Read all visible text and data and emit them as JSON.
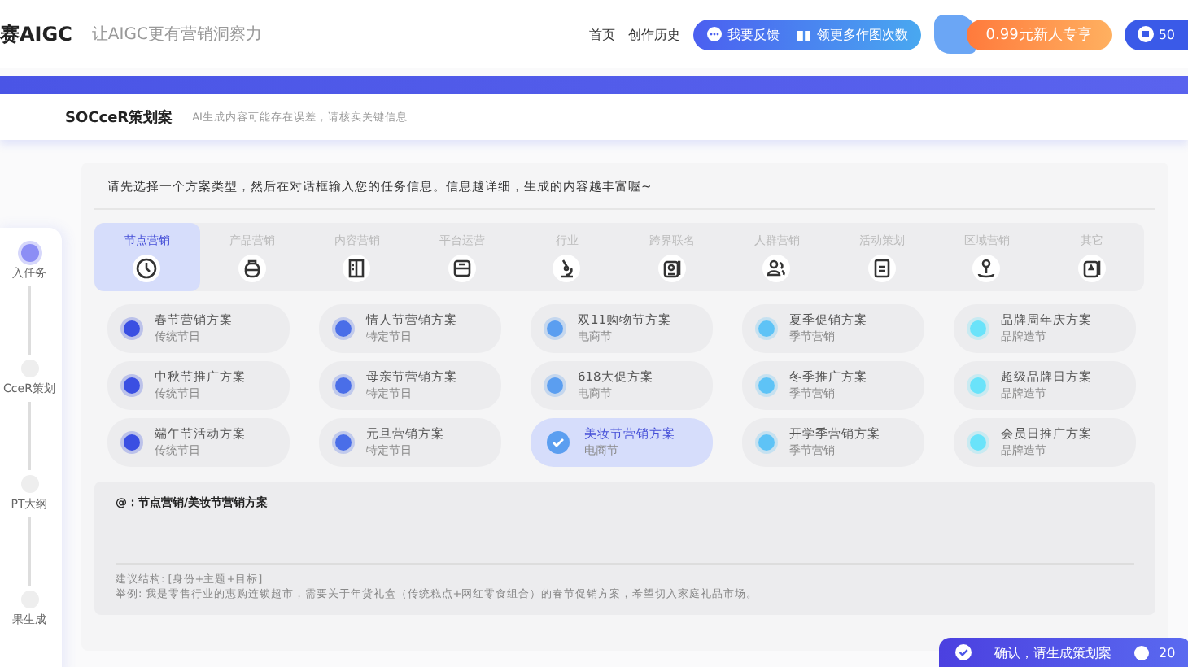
{
  "header": {
    "logo": "赛AIGC",
    "slogan": "让AIGC更有营销洞察力",
    "nav": [
      {
        "label": "首页"
      },
      {
        "label": "创作历史"
      }
    ],
    "feedback_button": "我要反馈",
    "more_button": "领更多作图次数",
    "promo_button": "0.99元新人专享",
    "credits": "50"
  },
  "title_bar": {
    "title": "SOCceR策划案",
    "notice": "AI生成内容可能存在误差，请核实关键信息"
  },
  "steps": [
    {
      "label": "入任务",
      "selected": true
    },
    {
      "label": "CceR策划",
      "selected": false
    },
    {
      "label": "PT大纲",
      "selected": false
    },
    {
      "label": "果生成",
      "selected": false
    }
  ],
  "instruction": "请先选择一个方案类型，然后在对话框输入您的任务信息。信息越详细，生成的内容越丰富喔~",
  "tabs": [
    {
      "label": "节点营销",
      "selected": true
    },
    {
      "label": "产品营销",
      "selected": false
    },
    {
      "label": "内容营销",
      "selected": false
    },
    {
      "label": "平台运营",
      "selected": false
    },
    {
      "label": "行业",
      "selected": false
    },
    {
      "label": "跨界联名",
      "selected": false
    },
    {
      "label": "人群营销",
      "selected": false
    },
    {
      "label": "活动策划",
      "selected": false
    },
    {
      "label": "区域营销",
      "selected": false
    },
    {
      "label": "其它",
      "selected": false
    }
  ],
  "plans": [
    {
      "title": "春节营销方案",
      "tag": "传统节日",
      "color": "#3a4fe2",
      "selected": false
    },
    {
      "title": "情人节营销方案",
      "tag": "特定节日",
      "color": "#4a6ee8",
      "selected": false
    },
    {
      "title": "双11购物节方案",
      "tag": "电商节",
      "color": "#5b9ef0",
      "selected": false
    },
    {
      "title": "夏季促销方案",
      "tag": "季节营销",
      "color": "#5ec3f6",
      "selected": false
    },
    {
      "title": "品牌周年庆方案",
      "tag": "品牌造节",
      "color": "#6ae3fa",
      "selected": false
    },
    {
      "title": "中秋节推广方案",
      "tag": "传统节日",
      "color": "#3a4fe2",
      "selected": false
    },
    {
      "title": "母亲节营销方案",
      "tag": "特定节日",
      "color": "#4a6ee8",
      "selected": false
    },
    {
      "title": "618大促方案",
      "tag": "电商节",
      "color": "#5b9ef0",
      "selected": false
    },
    {
      "title": "冬季推广方案",
      "tag": "季节营销",
      "color": "#5ec3f6",
      "selected": false
    },
    {
      "title": "超级品牌日方案",
      "tag": "品牌造节",
      "color": "#6ae3fa",
      "selected": false
    },
    {
      "title": "端午节活动方案",
      "tag": "传统节日",
      "color": "#3a4fe2",
      "selected": false
    },
    {
      "title": "元旦营销方案",
      "tag": "特定节日",
      "color": "#4a6ee8",
      "selected": false
    },
    {
      "title": "美妆节营销方案",
      "tag": "电商节",
      "color": "#5b9ef0",
      "selected": true
    },
    {
      "title": "开学季营销方案",
      "tag": "季节营销",
      "color": "#5ec3f6",
      "selected": false
    },
    {
      "title": "会员日推广方案",
      "tag": "品牌造节",
      "color": "#6ae3fa",
      "selected": false
    }
  ],
  "input": {
    "value": "@：节点营销/美妆节营销方案",
    "hint_structure": "建议结构: [身份+主题+目标]",
    "hint_example": "举例: 我是零售行业的惠购连锁超市，需要关于年货礼盒（传统糕点+网红零食组合）的春节促销方案，希望切入家庭礼品市场。"
  },
  "submit_button": {
    "label": "确认，请生成策划案",
    "count": "20"
  }
}
